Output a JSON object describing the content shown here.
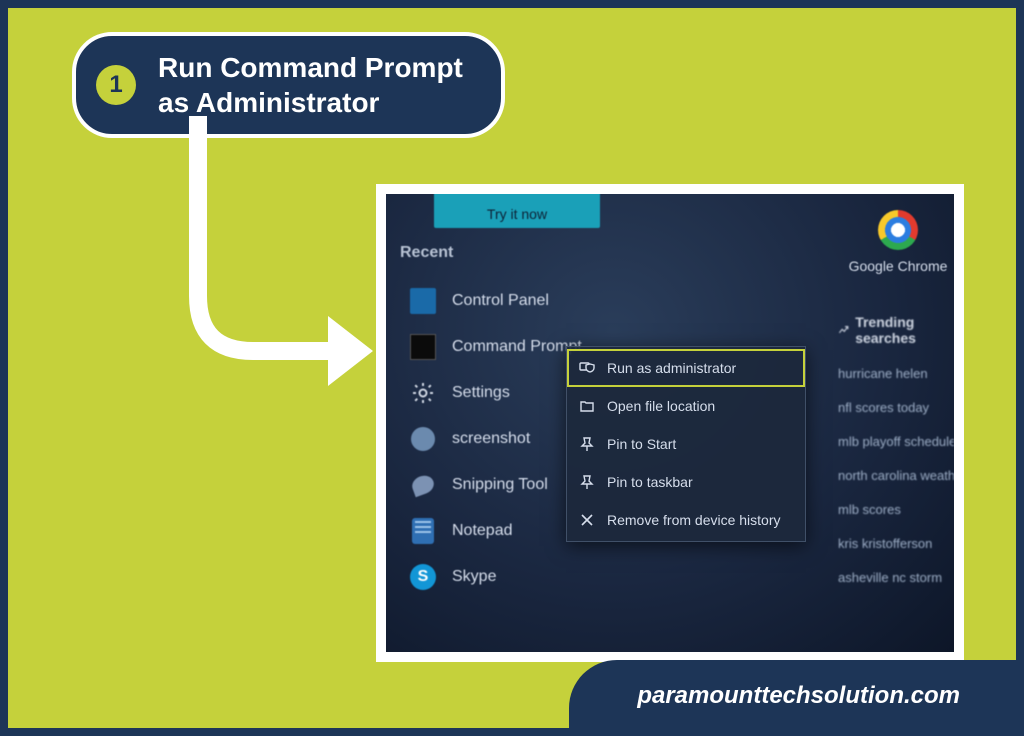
{
  "step": {
    "number": "1",
    "title_line1": "Run Command Prompt",
    "title_line2": "as Administrator"
  },
  "footer": {
    "site": "paramounttechsolution.com"
  },
  "screenshot": {
    "try_button": "Try it now",
    "recent_label": "Recent",
    "recent_items": [
      {
        "name": "Control Panel",
        "icon": "cp"
      },
      {
        "name": "Command Prompt",
        "icon": "cmd"
      },
      {
        "name": "Settings",
        "icon": "gear"
      },
      {
        "name": "screenshot",
        "icon": "shot"
      },
      {
        "name": "Snipping Tool",
        "icon": "snip"
      },
      {
        "name": "Notepad",
        "icon": "note"
      },
      {
        "name": "Skype",
        "icon": "skype"
      }
    ],
    "context_menu": [
      {
        "label": "Run as administrator",
        "icon": "shield",
        "highlight": true
      },
      {
        "label": "Open file location",
        "icon": "folder",
        "highlight": false
      },
      {
        "label": "Pin to Start",
        "icon": "pin",
        "highlight": false
      },
      {
        "label": "Pin to taskbar",
        "icon": "pin",
        "highlight": false
      },
      {
        "label": "Remove from device history",
        "icon": "close",
        "highlight": false
      }
    ],
    "chrome_label": "Google Chrome",
    "trending_header": "Trending searches",
    "trending": [
      "hurricane helen",
      "nfl scores today",
      "mlb playoff schedule",
      "north carolina weather",
      "mlb scores",
      "kris kristofferson",
      "asheville nc storm"
    ]
  }
}
